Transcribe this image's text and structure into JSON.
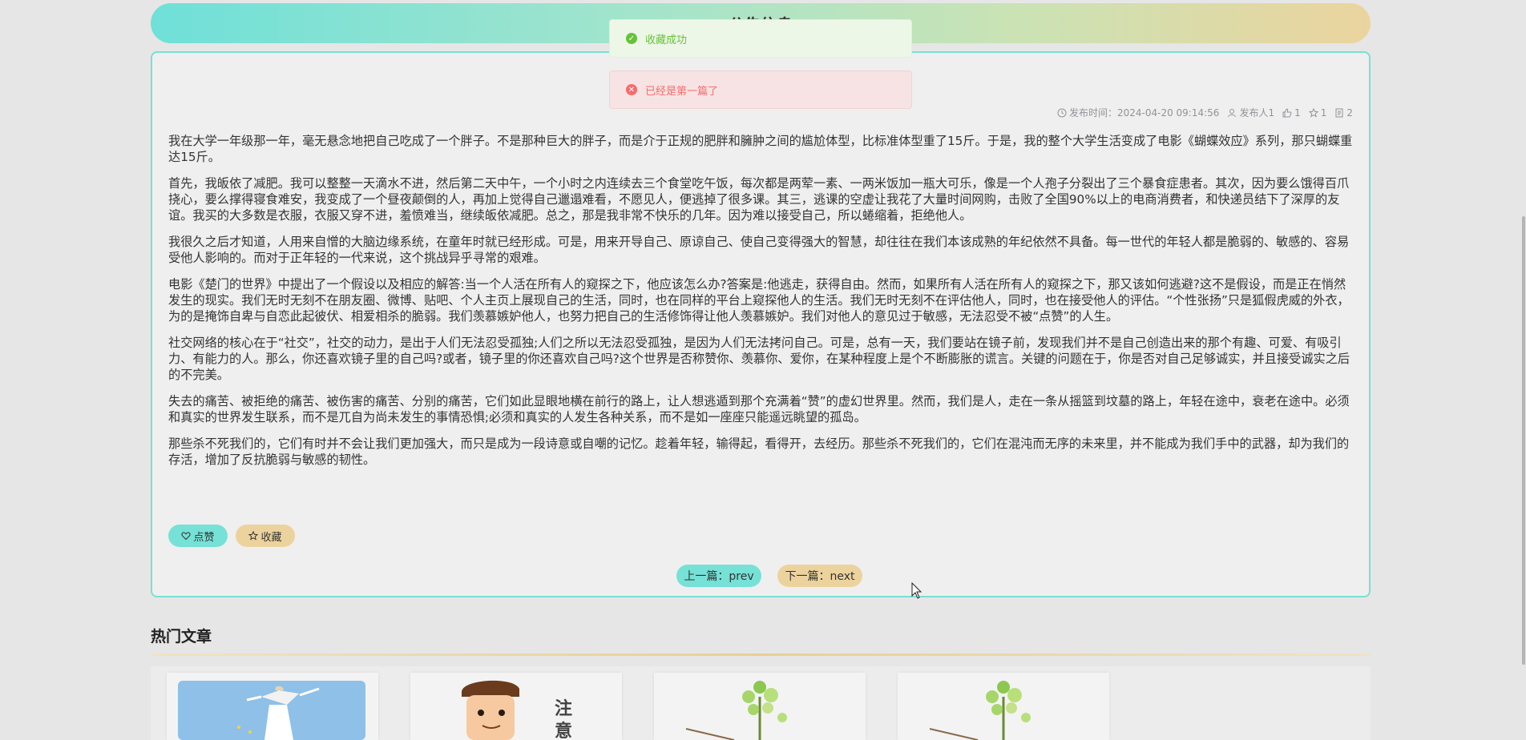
{
  "banner": {
    "title": "公告信息"
  },
  "toasts": {
    "success": "收藏成功",
    "error": "已经是第一篇了"
  },
  "article": {
    "meta": {
      "publish_time": "发布时间：2024-04-20 09:14:56",
      "publisher": "发布人1",
      "likes": "1",
      "favorites": "1",
      "views": "2"
    },
    "paragraphs": [
      "我在大学一年级那一年，毫无悬念地把自己吃成了一个胖子。不是那种巨大的胖子，而是介于正规的肥胖和臃肿之间的尴尬体型，比标准体型重了15斤。于是，我的整个大学生活变成了电影《蝴蝶效应》系列，那只蝴蝶重达15斤。",
      "首先，我皈依了减肥。我可以整整一天滴水不进，然后第二天中午，一个小时之内连续去三个食堂吃午饭，每次都是两荤一素、一两米饭加一瓶大可乐，像是一个人孢子分裂出了三个暴食症患者。其次，因为要么饿得百爪挠心，要么撑得寝食难安，我变成了一个昼夜颠倒的人，再加上觉得自己邋遢难看，不愿见人，便逃掉了很多课。其三，逃课的空虚让我花了大量时间网购，击败了全国90%以上的电商消费者，和快递员结下了深厚的友谊。我买的大多数是衣服，衣服又穿不进，羞愤难当，继续皈依减肥。总之，那是我非常不快乐的几年。因为难以接受自己，所以蜷缩着，拒绝他人。",
      "我很久之后才知道，人用来自憎的大脑边缘系统，在童年时就已经形成。可是，用来开导自己、原谅自己、使自己变得强大的智慧，却往往在我们本该成熟的年纪依然不具备。每一世代的年轻人都是脆弱的、敏感的、容易受他人影响的。而对于正年轻的一代来说，这个挑战异乎寻常的艰难。",
      "电影《楚门的世界》中提出了一个假设以及相应的解答:当一个人活在所有人的窥探之下，他应该怎么办?答案是:他逃走，获得自由。然而，如果所有人活在所有人的窥探之下，那又该如何逃避?这不是假设，而是正在悄然发生的现实。我们无时无刻不在朋友圈、微博、贴吧、个人主页上展现自己的生活，同时，也在同样的平台上窥探他人的生活。我们无时无刻不在评估他人，同时，也在接受他人的评估。“个性张扬”只是狐假虎威的外衣，为的是掩饰自卑与自恋此起彼伏、相爱相杀的脆弱。我们羡慕嫉妒他人，也努力把自己的生活修饰得让他人羡慕嫉妒。我们对他人的意见过于敏感，无法忍受不被“点赞”的人生。",
      "社交网络的核心在于“社交”，社交的动力，是出于人们无法忍受孤独;人们之所以无法忍受孤独，是因为人们无法拷问自己。可是，总有一天，我们要站在镜子前，发现我们并不是自己创造出来的那个有趣、可爱、有吸引力、有能力的人。那么，你还喜欢镜子里的自己吗?或者，镜子里的你还喜欢自己吗?这个世界是否称赞你、羡慕你、爱你，在某种程度上是个不断膨胀的谎言。关键的问题在于，你是否对自己足够诚实，并且接受诚实之后的不完美。",
      "失去的痛苦、被拒绝的痛苦、被伤害的痛苦、分别的痛苦，它们如此显眼地横在前行的路上，让人想逃遁到那个充满着“赞”的虚幻世界里。然而，我们是人，走在一条从摇篮到坟墓的路上，年轻在途中，衰老在途中。必须和真实的世界发生联系，而不是兀自为尚未发生的事情恐惧;必须和真实的人发生各种关系，而不是如一座座只能遥远眺望的孤岛。",
      "那些杀不死我们的，它们有时并不会让我们更加强大，而只是成为一段诗意或自嘲的记忆。趁着年轻，输得起，看得开，去经历。那些杀不死我们的，它们在混沌而无序的未来里，并不能成为我们手中的武器，却为我们的存活，增加了反抗脆弱与敏感的韧性。"
    ],
    "buttons": {
      "like": "点赞",
      "favorite": "收藏",
      "prev": "上一篇：prev",
      "next": "下一篇：next"
    }
  },
  "hot": {
    "title": "热门文章"
  },
  "icons": {
    "clock": "clock-icon",
    "user": "user-icon",
    "thumb": "thumb-up-icon",
    "star": "star-icon",
    "doc": "document-icon",
    "heart": "heart-icon",
    "success": "check-circle-icon",
    "error": "close-circle-icon"
  },
  "colors": {
    "accent_teal": "#76e1d6",
    "accent_tan": "#ecd39d",
    "success": "#67c23a",
    "error": "#f56c6c"
  }
}
